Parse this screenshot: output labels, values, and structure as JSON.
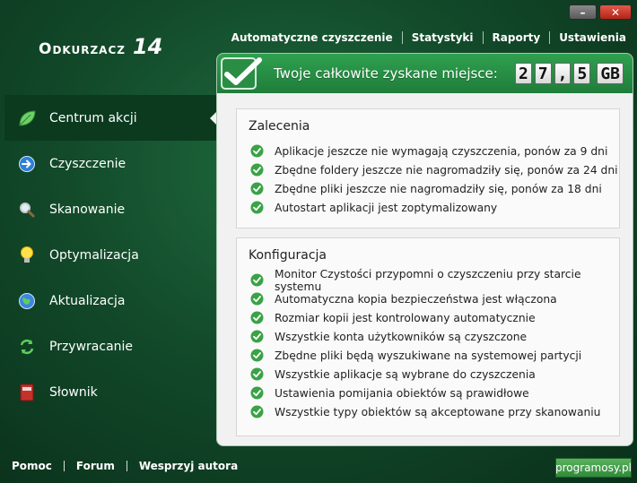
{
  "window": {
    "minimize_glyph": "–",
    "close_glyph": "✕"
  },
  "logo": {
    "name": "Odkurzacz",
    "version": "14"
  },
  "top_menu": [
    {
      "label": "Automatyczne czyszczenie"
    },
    {
      "label": "Statystyki"
    },
    {
      "label": "Raporty"
    },
    {
      "label": "Ustawienia"
    }
  ],
  "sidebar": {
    "items": [
      {
        "label": "Centrum akcji",
        "icon": "leaf-icon",
        "active": true
      },
      {
        "label": "Czyszczenie",
        "icon": "arrow-right-circle-icon"
      },
      {
        "label": "Skanowanie",
        "icon": "magnifier-icon"
      },
      {
        "label": "Optymalizacja",
        "icon": "lightbulb-icon"
      },
      {
        "label": "Aktualizacja",
        "icon": "globe-icon"
      },
      {
        "label": "Przywracanie",
        "icon": "restore-arrows-icon"
      },
      {
        "label": "Słownik",
        "icon": "dictionary-book-icon"
      }
    ]
  },
  "space": {
    "label": "Twoje całkowite zyskane miejsce:",
    "digits": [
      "2",
      "7",
      ",",
      "5"
    ],
    "unit": "GB"
  },
  "recommendations": {
    "title": "Zalecenia",
    "items": [
      "Aplikacje jeszcze nie wymagają czyszczenia, ponów za 9 dni",
      "Zbędne foldery jeszcze nie nagromadziły się, ponów za 24 dni",
      "Zbędne pliki jeszcze nie nagromadziły się, ponów za 18 dni",
      "Autostart aplikacji jest zoptymalizowany"
    ]
  },
  "configuration": {
    "title": "Konfiguracja",
    "items": [
      "Monitor Czystości przypomni o czyszczeniu przy starcie systemu",
      "Automatyczna kopia bezpieczeństwa jest włączona",
      "Rozmiar kopii jest kontrolowany automatycznie",
      "Wszystkie konta użytkowników są czyszczone",
      "Zbędne pliki będą wyszukiwane na systemowej partycji",
      "Wszystkie aplikacje są wybrane do czyszczenia",
      "Ustawienia pomijania obiektów są prawidłowe",
      "Wszystkie typy obiektów są akceptowane przy skanowaniu"
    ]
  },
  "footer": {
    "links": [
      {
        "label": "Pomoc"
      },
      {
        "label": "Forum"
      },
      {
        "label": "Wesprzyj autora"
      }
    ],
    "badge": "programosy.pl"
  },
  "colors": {
    "accent_green": "#2fa04f",
    "panel_bg": "#f1f1f1",
    "check_green": "#3aa247"
  }
}
